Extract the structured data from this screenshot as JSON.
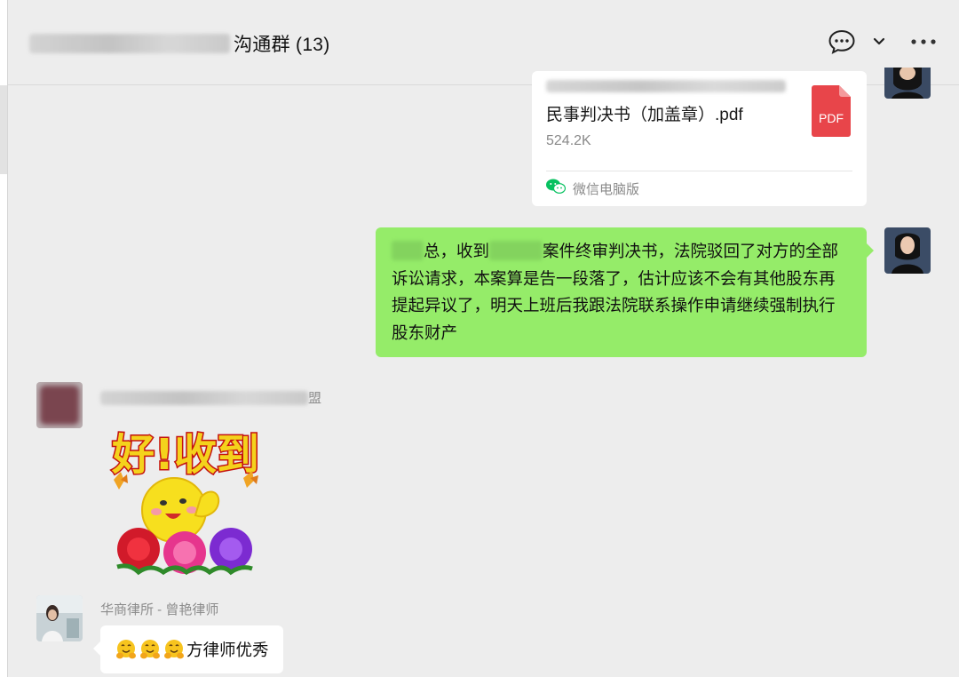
{
  "header": {
    "title": "沟通群 (13)",
    "actions": [
      "chat-bubble-icon",
      "chevron-down-icon",
      "more-icon"
    ]
  },
  "messages": {
    "file_card": {
      "file_name": "民事判决书（加盖章）.pdf",
      "file_size": "524.2K",
      "file_type": "PDF",
      "source": "微信电脑版"
    },
    "text_bubble": {
      "seg1": "总，收到",
      "seg2": "案件终审判决书，法院驳回了对方的全部诉讼请求，本案算是告一段落了，估计应该不会有其他股东再提起异议了，明天上班后我跟法院联系操作申请继续强制执行股东财产"
    },
    "sticker_sender_suffix": "盟",
    "sticker": {
      "caption": "好!收到"
    },
    "reply": {
      "sender": "华商律所 - 曾艳律师",
      "text": "方律师优秀"
    }
  },
  "colors": {
    "bubble_green": "#95ec69",
    "pdf_red": "#e8454a",
    "wechat_green": "#07c160"
  }
}
